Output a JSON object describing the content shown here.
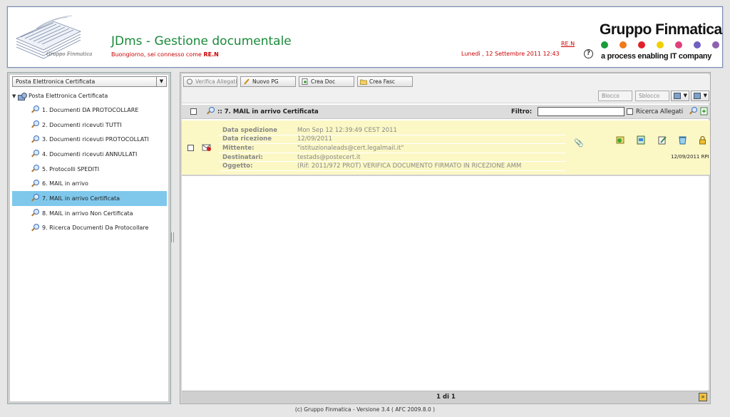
{
  "header": {
    "app_title": "JDms - Gestione documentale",
    "greeting": "Buongiorno, sei connesso come",
    "user": "RE.N",
    "user_link": "RE.N",
    "datetime": "Lunedì   , 12 Settembre 2011 12:43",
    "help": "?",
    "brand": "Gruppo Finmatica",
    "tagline": "a process enabling IT company",
    "logo_caption": "Gruppo Finmatica",
    "brand_dot_colors": [
      "#1a9a3a",
      "#f07a1a",
      "#e0202a",
      "#f0d000",
      "#e0407a",
      "#7060c0",
      "#9060b0"
    ]
  },
  "sidebar": {
    "select_value": "Posta Elettronica Certificata",
    "root": "Posta Elettronica Certificata",
    "items": [
      "1. Documenti DA PROTOCOLLARE",
      "2. Documenti ricevuti TUTTI",
      "3. Documenti ricevuti PROTOCOLLATI",
      "4. Documenti ricevuti ANNULLATI",
      "5. Protocolli SPEDITI",
      "6. MAIL in arrivo",
      "7. MAIL in arrivo Certificata",
      "8. MAIL in arrivo Non Certificata",
      "9. Ricerca Documenti Da Protocollare"
    ],
    "selected_index": 6
  },
  "toolbar": {
    "verifica_allegati": "Verifica Allegati",
    "nuovo_pg": "Nuovo PG",
    "crea_doc": "Crea Doc",
    "crea_fasc": "Crea Fasc",
    "blocco": "Blocco",
    "sblocco": "Sblocco"
  },
  "list": {
    "title": ":: 7. MAIL in arrivo Certificata",
    "filtro_label": "Filtro:",
    "filtro_value": "",
    "ricerca_allegati": "Ricerca Allegati"
  },
  "message": {
    "fields": [
      {
        "label": "Data spedizione",
        "value": "Mon Sep 12 12:39:49 CEST 2011"
      },
      {
        "label": "Data ricezione",
        "value": "12/09/2011"
      },
      {
        "label": "Mittente:",
        "value": "\"istituzionaleads@cert.legalmail.it\""
      },
      {
        "label": "Destinatari:",
        "value": "testads@postecert.it"
      },
      {
        "label": "Oggetto:",
        "value": "(Rif: 2011/972 PROT) VERIFICA DOCUMENTO FIRMATO IN RICEZIONE AMM"
      }
    ],
    "date_user": "12/09/2011 RPI"
  },
  "pager": "1 di 1",
  "copyright": "(c) Gruppo Finmatica - Versione 3.4  ( AFC 2009.8.0 )"
}
